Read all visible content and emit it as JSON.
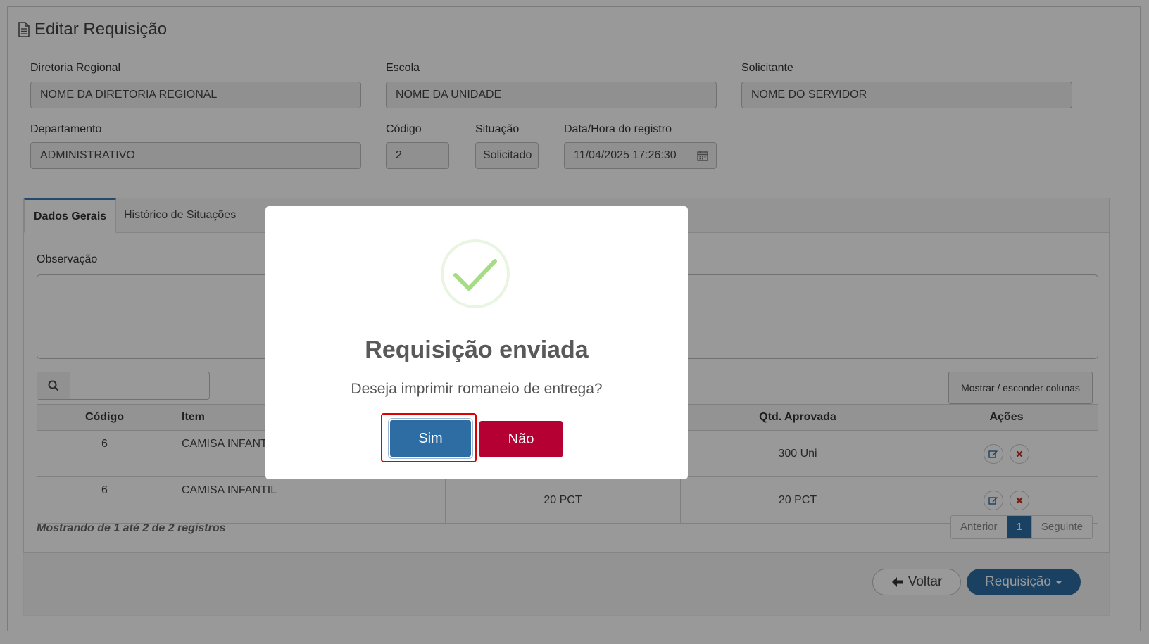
{
  "page": {
    "title": "Editar Requisição",
    "title_icon": "document-icon"
  },
  "form": {
    "diretoria": {
      "label": "Diretoria Regional",
      "value": "NOME DA DIRETORIA REGIONAL"
    },
    "escola": {
      "label": "Escola",
      "value": "NOME DA UNIDADE"
    },
    "solicitante": {
      "label": "Solicitante",
      "value": "NOME DO SERVIDOR"
    },
    "departamento": {
      "label": "Departamento",
      "value": "ADMINISTRATIVO"
    },
    "codigo": {
      "label": "Código",
      "value": "2"
    },
    "situacao": {
      "label": "Situação",
      "value": "Solicitado"
    },
    "data_registro": {
      "label": "Data/Hora do registro",
      "value": "11/04/2025 17:26:30",
      "icon": "calendar-icon"
    }
  },
  "tabs": [
    {
      "label": "Dados Gerais",
      "active": true
    },
    {
      "label": "Histórico de Situações",
      "active": false
    }
  ],
  "observacao": {
    "label": "Observação"
  },
  "table": {
    "search_icon": "search-icon",
    "column_toggle_label": "Mostrar / esconder colunas",
    "headers": [
      "Código",
      "Item",
      "",
      "Qtd. Aprovada",
      "Ações"
    ],
    "rows": [
      {
        "codigo": "6",
        "item": "CAMISA INFANTIL",
        "qtd_solicitada": "",
        "qtd_aprovada": "300 Uni"
      },
      {
        "codigo": "6",
        "item": "CAMISA INFANTIL",
        "qtd_solicitada": "20 PCT",
        "qtd_aprovada": "20 PCT"
      }
    ],
    "footer_info": "Mostrando de 1 até 2 de 2 registros",
    "pager": {
      "prev": "Anterior",
      "current": "1",
      "next": "Seguinte"
    }
  },
  "actions": {
    "back_label": "Voltar",
    "requisicao_label": "Requisição"
  },
  "modal": {
    "title": "Requisição enviada",
    "text": "Deseja imprimir romaneio de entrega?",
    "confirm_label": "Sim",
    "cancel_label": "Não",
    "icon": "success-check-icon",
    "colors": {
      "confirm": "#2e6da4",
      "cancel": "#b40033",
      "check": "#a5dc86"
    }
  }
}
